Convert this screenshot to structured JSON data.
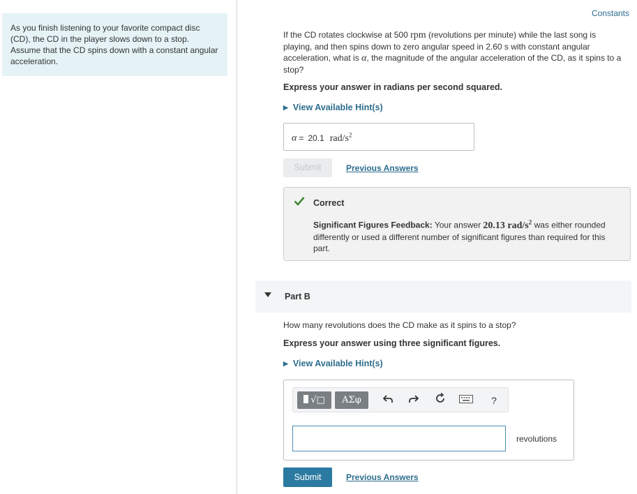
{
  "intro": {
    "text": "As you finish listening to your favorite compact disc (CD), the CD in the player slows down to a stop. Assume that the CD spins down with a constant angular acceleration."
  },
  "constants_link": "Constants",
  "part_a": {
    "question_1": "If the CD rotates clockwise at 500 ",
    "question_rpm": "rpm",
    "question_2": " (revolutions per minute) while the last song is playing, and then spins down to zero angular speed in 2.60 s with constant angular acceleration, what is ",
    "question_alpha": "α",
    "question_3": ", the magnitude of the angular acceleration of the CD, as it spins to a stop?",
    "instruction": "Express your answer in radians per second squared.",
    "hint_label": "View Available Hint(s)",
    "answer_label": "α",
    "answer_eq": "=",
    "answer_value": "20.1",
    "answer_unit": "rad/s",
    "answer_unit_exp": "2",
    "submit_label": "Submit",
    "previous_answers": "Previous Answers",
    "feedback": {
      "status": "Correct",
      "title": "Significant Figures Feedback:",
      "text_1": " Your answer ",
      "answer": "20.13 rad/s",
      "answer_exp": "2",
      "text_2": " was either rounded differently or used a different number of significant figures than required for this part."
    }
  },
  "part_b": {
    "title": "Part B",
    "question": "How many revolutions does the CD make as it spins to a stop?",
    "instruction": "Express your answer using three significant figures.",
    "hint_label": "View Available Hint(s)",
    "toolbar": {
      "templates_label": "√□",
      "symbols_label": "ΑΣφ",
      "help_label": "?"
    },
    "input_value": "",
    "units": "revolutions",
    "submit_label": "Submit",
    "previous_answers": "Previous Answers"
  }
}
